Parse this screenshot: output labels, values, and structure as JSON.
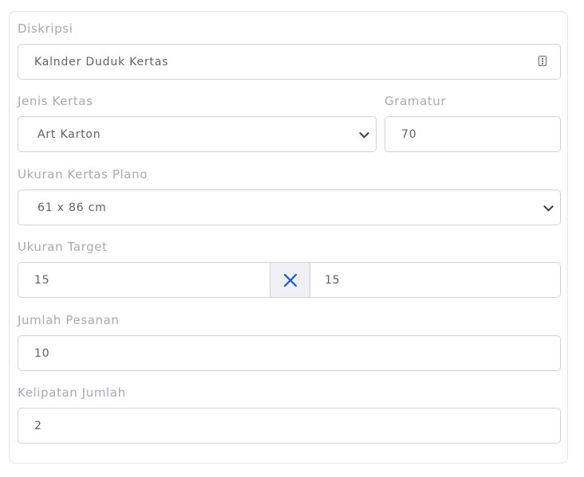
{
  "form": {
    "description": {
      "label": "Diskripsi",
      "value": "Kalnder Duduk Kertas",
      "icon": "contact-list-icon"
    },
    "paper_type": {
      "label": "Jenis Kertas",
      "selected": "Art Karton"
    },
    "grammage": {
      "label": "Gramatur",
      "value": "70"
    },
    "plano_size": {
      "label": "Ukuran Kertas Plano",
      "selected": "61 x 86 cm"
    },
    "target_size": {
      "label": "Ukuran Target",
      "width": "15",
      "height": "15",
      "separator_icon": "times-icon",
      "separator_color": "#1a56db"
    },
    "order_quantity": {
      "label": "Jumlah Pesanan",
      "value": "10"
    },
    "quantity_multiple": {
      "label": "Kelipatan Jumlah",
      "value": "2"
    }
  },
  "colors": {
    "label": "#a7aab4",
    "border": "#d0d4da",
    "text": "#5f6368",
    "addon_bg": "#eef0f3"
  }
}
